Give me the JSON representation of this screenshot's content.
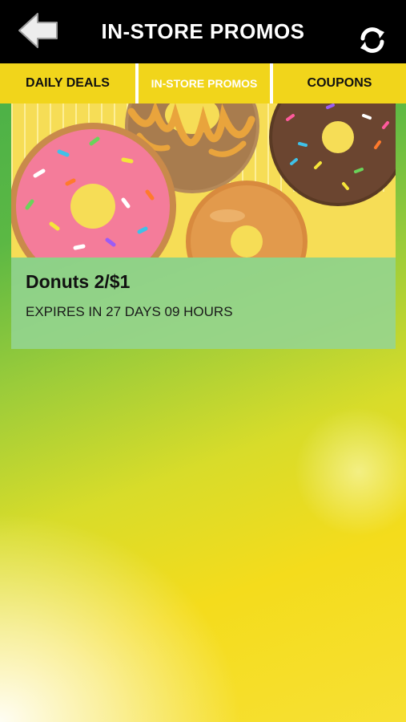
{
  "header": {
    "title": "IN-STORE PROMOS",
    "back_icon": "back-arrow-icon",
    "refresh_icon": "refresh-icon"
  },
  "tabs": [
    {
      "label": "DAILY DEALS",
      "active": false
    },
    {
      "label": "IN-STORE PROMOS",
      "active": true
    },
    {
      "label": "COUPONS",
      "active": false
    }
  ],
  "promo": {
    "title": "Donuts 2/$1",
    "expiry": "EXPIRES IN 27 DAYS 09 HOURS"
  },
  "colors": {
    "topbar": "#000000",
    "tab_bar": "#f1d51b",
    "card_body": "#94d594",
    "image_background": "#f7df5a"
  }
}
